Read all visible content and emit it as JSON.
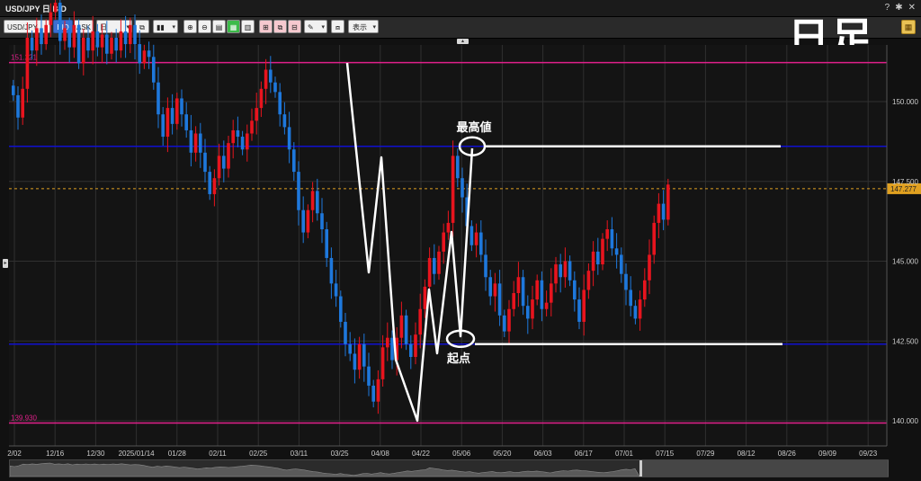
{
  "window": {
    "title": "USD/JPY 日 BID"
  },
  "window_controls": {
    "help": "?",
    "settings": "✱",
    "close": "✕"
  },
  "toolbar": {
    "symbol": "USD/JPY",
    "bid_label": "BID",
    "ask_label": "ASK",
    "period": "日",
    "display_label": "表示"
  },
  "big_title": "日足",
  "annotations": {
    "high_label": "最高値",
    "start_label": "起点"
  },
  "colors": {
    "background": "#141414",
    "up": "#e8141e",
    "down": "#1e78dc",
    "magenta_line": "#e0208a",
    "blue_line": "#1010d0",
    "current_price": "#e0a020",
    "white_lines": "#ffffff",
    "grid": "#303030"
  },
  "chart_data": {
    "type": "candlestick",
    "symbol": "USD/JPY",
    "ylim": [
      139.4,
      152.2
    ],
    "y_ticks": [
      140.0,
      142.5,
      145.0,
      147.5,
      150.0
    ],
    "y_tick_labels": [
      "140.000",
      "142.500",
      "145.000",
      "147.500",
      "150.000"
    ],
    "x_tick_labels": [
      "2/02",
      "12/16",
      "12/30",
      "2025/01/14",
      "01/28",
      "02/11",
      "02/25",
      "03/11",
      "03/25",
      "04/08",
      "04/22",
      "05/06",
      "05/20",
      "06/03",
      "06/17",
      "07/01",
      "07/15",
      "07/29",
      "08/12",
      "08/26",
      "09/09",
      "09/23"
    ],
    "horizontal_lines": [
      {
        "value": 151.221,
        "label": "151.221",
        "color": "#e0208a"
      },
      {
        "value": 148.6,
        "color": "#1010d0"
      },
      {
        "value": 142.4,
        "color": "#1010d0"
      },
      {
        "value": 139.93,
        "label": "139.930",
        "color": "#e0208a"
      }
    ],
    "current_price": {
      "value": 147.27,
      "label": "147.277"
    },
    "key_points": {
      "high": 148.6,
      "start": 142.4
    },
    "closes": [
      150.2,
      149.5,
      150.4,
      152.0,
      151.6,
      152.3,
      151.8,
      152.4,
      152.8,
      153.1,
      151.9,
      152.3,
      151.7,
      152.4,
      151.2,
      152.0,
      151.6,
      152.2,
      151.7,
      152.1,
      151.5,
      152.0,
      151.6,
      152.2,
      151.8,
      152.4,
      151.8,
      151.2,
      151.6,
      151.4,
      150.6,
      149.6,
      148.9,
      149.8,
      149.3,
      150.1,
      149.6,
      149.1,
      148.4,
      149.0,
      148.4,
      147.8,
      147.1,
      147.6,
      148.3,
      147.9,
      148.7,
      149.1,
      148.9,
      148.5,
      149.0,
      149.4,
      149.8,
      150.4,
      151.0,
      150.6,
      150.3,
      149.6,
      149.2,
      148.5,
      147.8,
      146.6,
      145.9,
      146.6,
      147.2,
      146.5,
      146.0,
      145.1,
      144.3,
      143.9,
      143.1,
      142.4,
      142.1,
      141.6,
      142.4,
      141.7,
      141.1,
      140.6,
      141.3,
      142.3,
      142.6,
      141.9,
      142.6,
      143.3,
      142.4,
      142.0,
      142.7,
      143.5,
      144.2,
      145.1,
      144.6,
      145.3,
      145.9,
      146.2,
      148.3,
      147.6,
      147.0,
      146.1,
      145.5,
      145.9,
      145.2,
      144.5,
      143.9,
      144.3,
      143.3,
      142.8,
      143.5,
      144.0,
      144.5,
      143.6,
      143.2,
      143.8,
      144.4,
      143.5,
      143.7,
      144.3,
      144.9,
      144.5,
      145.0,
      144.4,
      143.8,
      143.1,
      144.1,
      144.7,
      145.3,
      144.9,
      145.7,
      146.0,
      145.4,
      145.2,
      144.6,
      144.1,
      143.6,
      143.2,
      143.8,
      144.4,
      145.2,
      146.2,
      146.8,
      146.3,
      147.4
    ]
  }
}
